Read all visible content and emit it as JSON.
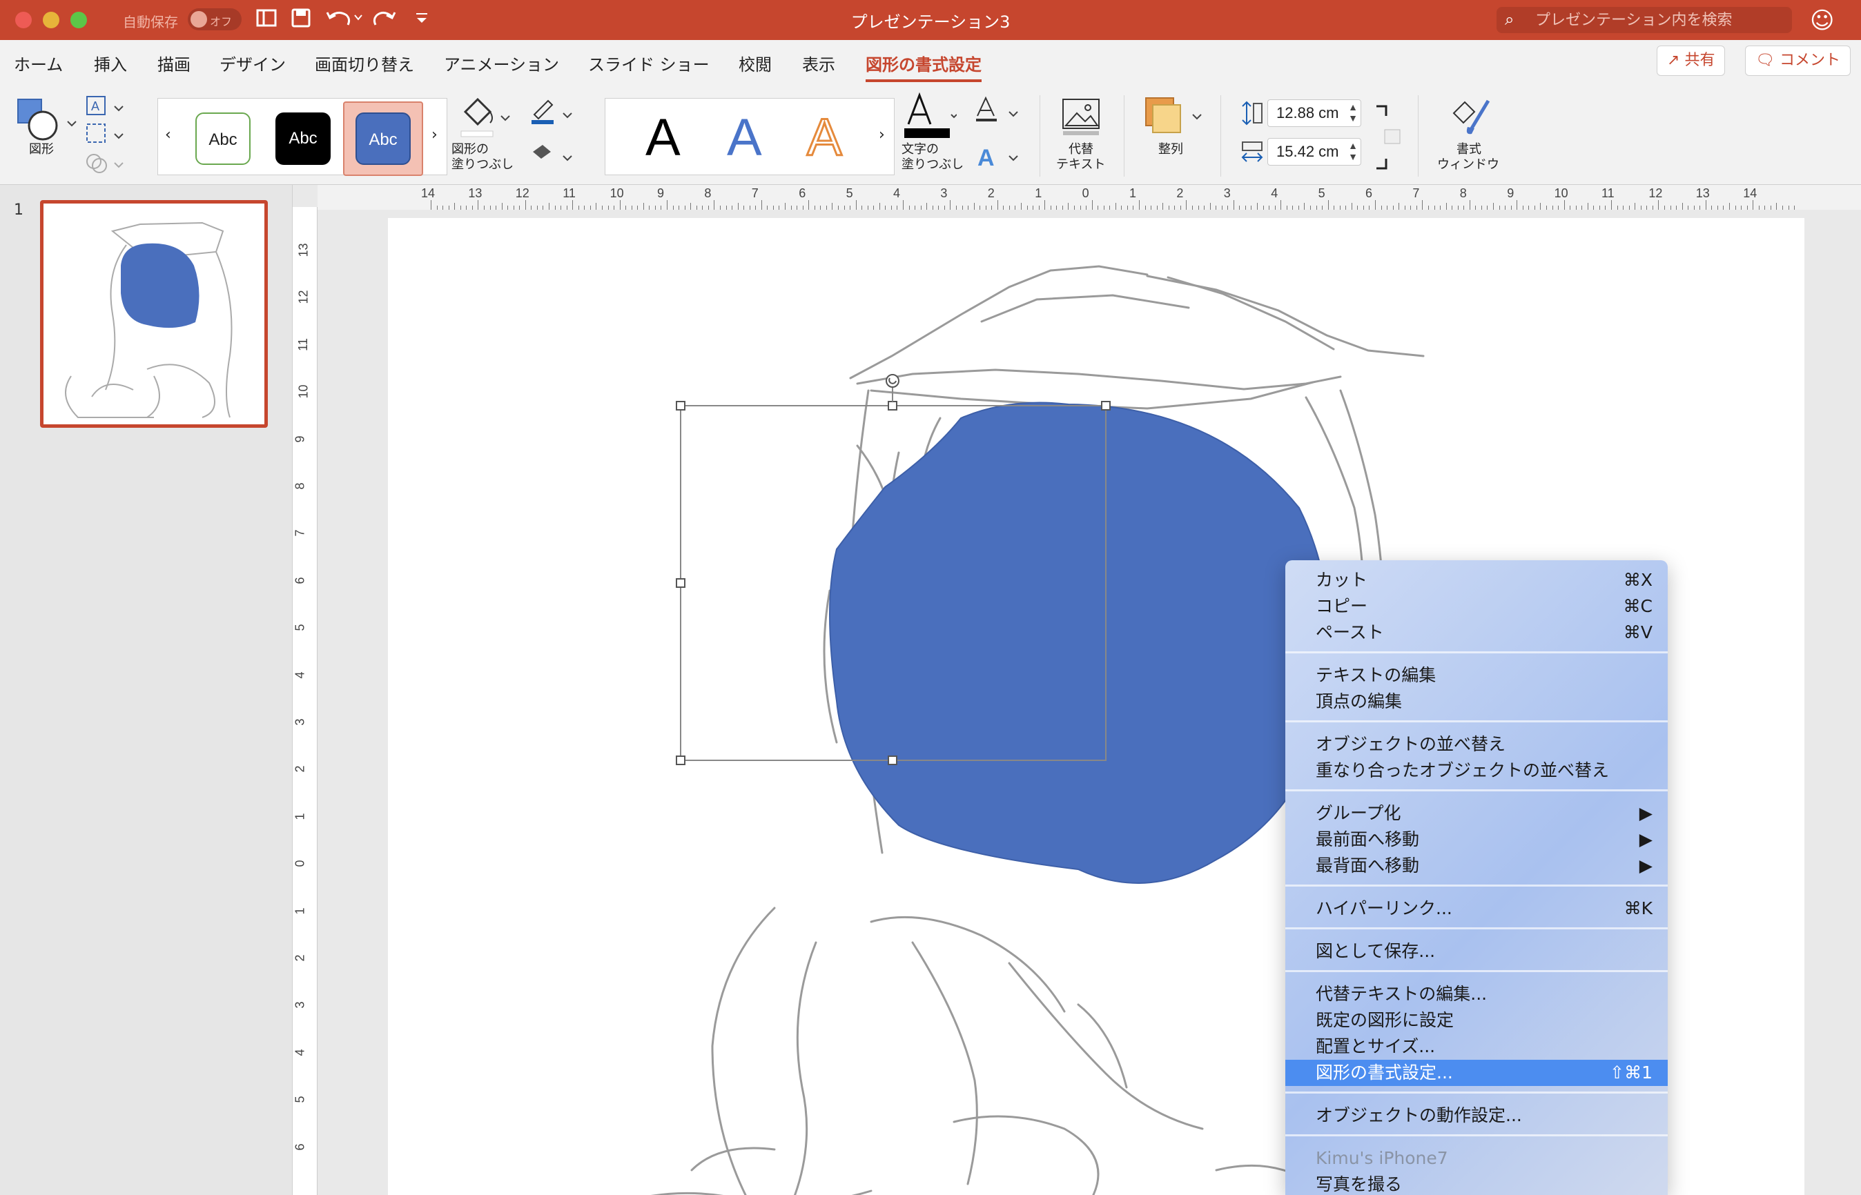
{
  "titlebar": {
    "autosave_label": "自動保存",
    "autosave_state": "オフ",
    "doc_title": "プレゼンテーション3",
    "search_placeholder": "プレゼンテーション内を検索"
  },
  "tabs": [
    {
      "label": "ホーム"
    },
    {
      "label": "挿入"
    },
    {
      "label": "描画"
    },
    {
      "label": "デザイン"
    },
    {
      "label": "画面切り替え"
    },
    {
      "label": "アニメーション"
    },
    {
      "label": "スライド ショー"
    },
    {
      "label": "校閲"
    },
    {
      "label": "表示"
    },
    {
      "label": "図形の書式設定",
      "active": true
    }
  ],
  "top_buttons": {
    "share": "共有",
    "comment": "コメント"
  },
  "ribbon": {
    "shape_label": "図形",
    "style_swatches": [
      "Abc",
      "Abc",
      "Abc"
    ],
    "shape_fill_label_1": "図形の",
    "shape_fill_label_2": "塗りつぶし",
    "wordart": [
      "A",
      "A",
      "A"
    ],
    "text_fill_label_1": "文字の",
    "text_fill_label_2": "塗りつぶし",
    "alt_text_label_1": "代替",
    "alt_text_label_2": "テキスト",
    "arrange_label": "整列",
    "height_value": "12.88 cm",
    "width_value": "15.42 cm",
    "format_pane_label_1": "書式",
    "format_pane_label_2": "ウィンドウ"
  },
  "slide_panel": {
    "slide_number": "1"
  },
  "ruler": {
    "h_ticks": [
      "14",
      "13",
      "12",
      "11",
      "10",
      "9",
      "8",
      "7",
      "6",
      "5",
      "4",
      "3",
      "2",
      "1",
      "0",
      "1",
      "2",
      "3",
      "4",
      "5",
      "6",
      "7",
      "8",
      "9",
      "10",
      "11",
      "12",
      "13",
      "14"
    ],
    "v_ticks": [
      "13",
      "12",
      "11",
      "10",
      "9",
      "8",
      "7",
      "6",
      "5",
      "4",
      "3",
      "2",
      "1",
      "0",
      "1",
      "2",
      "3",
      "4",
      "5",
      "6"
    ]
  },
  "context_menu": {
    "groups": [
      [
        {
          "label": "カット",
          "shortcut": "⌘X"
        },
        {
          "label": "コピー",
          "shortcut": "⌘C"
        },
        {
          "label": "ペースト",
          "shortcut": "⌘V"
        }
      ],
      [
        {
          "label": "テキストの編集",
          "shortcut": ""
        },
        {
          "label": "頂点の編集",
          "shortcut": ""
        }
      ],
      [
        {
          "label": "オブジェクトの並べ替え",
          "shortcut": ""
        },
        {
          "label": "重なり合ったオブジェクトの並べ替え",
          "shortcut": ""
        }
      ],
      [
        {
          "label": "グループ化",
          "shortcut": "▶"
        },
        {
          "label": "最前面へ移動",
          "shortcut": "▶"
        },
        {
          "label": "最背面へ移動",
          "shortcut": "▶"
        }
      ],
      [
        {
          "label": "ハイパーリンク...",
          "shortcut": "⌘K"
        }
      ],
      [
        {
          "label": "図として保存...",
          "shortcut": ""
        }
      ],
      [
        {
          "label": "代替テキストの編集...",
          "shortcut": ""
        },
        {
          "label": "既定の図形に設定",
          "shortcut": ""
        },
        {
          "label": "配置とサイズ...",
          "shortcut": ""
        },
        {
          "label": "図形の書式設定...",
          "shortcut": "⇧⌘1",
          "active": true
        }
      ],
      [
        {
          "label": "オブジェクトの動作設定...",
          "shortcut": ""
        }
      ],
      [
        {
          "label": "Kimu's iPhone7",
          "shortcut": "",
          "disabled": true
        },
        {
          "label": "写真を撮る",
          "shortcut": ""
        }
      ]
    ]
  },
  "colors": {
    "accent": "#c6462e",
    "shape_fill": "#4a6fbd",
    "menu_highlight": "#4c8df0"
  }
}
